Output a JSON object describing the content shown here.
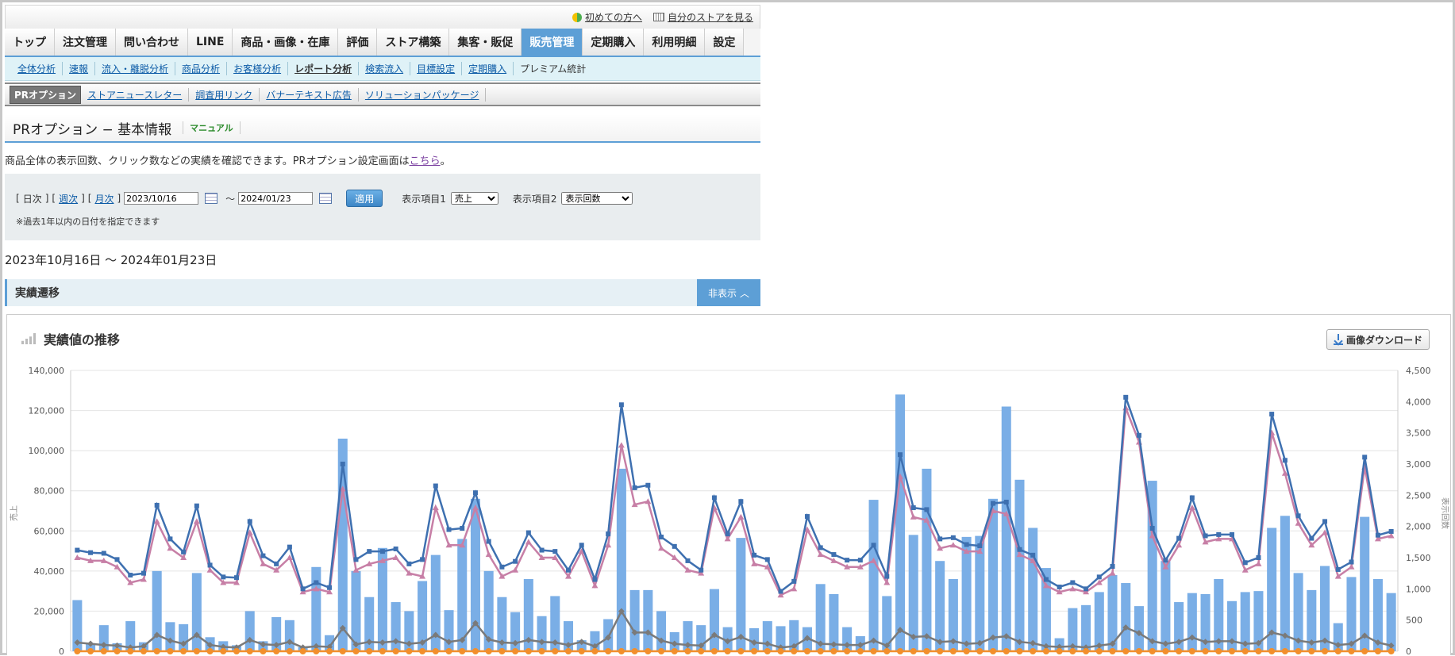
{
  "toplinks": {
    "first_time": "初めての方へ",
    "view_store": "自分のストアを見る"
  },
  "mainnav": [
    {
      "label": "トップ"
    },
    {
      "label": "注文管理"
    },
    {
      "label": "問い合わせ"
    },
    {
      "label": "LINE"
    },
    {
      "label": "商品・画像・在庫"
    },
    {
      "label": "評価"
    },
    {
      "label": "ストア構築"
    },
    {
      "label": "集客・販促"
    },
    {
      "label": "販売管理",
      "active": true
    },
    {
      "label": "定期購入"
    },
    {
      "label": "利用明細"
    },
    {
      "label": "設定"
    }
  ],
  "subnav": [
    "全体分析",
    "速報",
    "流入・離脱分析",
    "商品分析",
    "お客様分析",
    "レポート分析",
    "検索流入",
    "目標設定",
    "定期購入",
    "プレミアム統計"
  ],
  "thirdnav": [
    "PRオプション",
    "ストアニュースレター",
    "調査用リンク",
    "バナーテキスト広告",
    "ソリューションパッケージ"
  ],
  "page": {
    "title": "PRオプション − 基本情報",
    "manual": "マニュアル",
    "desc_prefix": "商品全体の表示回数、クリック数などの実績を確認できます。PRオプション設定画面は",
    "desc_link": "こちら",
    "desc_suffix": "。"
  },
  "filter": {
    "daily": "日次",
    "weekly": "週次",
    "monthly": "月次",
    "from": "2023/10/16",
    "to": "2024/01/23",
    "tilde": "〜",
    "apply": "適用",
    "item1_label": "表示項目1",
    "item1_value": "売上",
    "item2_label": "表示項目2",
    "item2_value": "表示回数",
    "note": "※過去1年以内の日付を指定できます"
  },
  "period": "2023年10月16日 〜 2024年01月23日",
  "section": {
    "title": "実績遷移",
    "hide": "非表示"
  },
  "chart_header": {
    "title": "実績値の推移",
    "download": "画像ダウンロード"
  },
  "chart_data": {
    "type": "bar",
    "y_left": {
      "label": "売上",
      "min": 0,
      "max": 140000,
      "ticks": [
        "0",
        "20,000",
        "40,000",
        "60,000",
        "80,000",
        "100,000",
        "120,000",
        "140,000"
      ]
    },
    "y_right": {
      "label": "表示回数",
      "min": 0,
      "max": 4500,
      "ticks": [
        "0",
        "500",
        "1,000",
        "1,500",
        "2,000",
        "2,500",
        "3,000",
        "3,500",
        "4,000",
        "4,500"
      ]
    },
    "bars_sales": [
      25500,
      4000,
      13000,
      4000,
      15000,
      4500,
      40000,
      14500,
      13500,
      39000,
      7000,
      5000,
      3000,
      20000,
      5000,
      17000,
      15500,
      2000,
      42000,
      8000,
      106000,
      40000,
      27000,
      51500,
      24500,
      20000,
      35000,
      48000,
      20500,
      56000,
      76000,
      40000,
      27000,
      19500,
      36000,
      17500,
      27500,
      15000,
      5500,
      10000,
      16000,
      91000,
      30500,
      30500,
      20000,
      9500,
      15000,
      13000,
      31000,
      12000,
      56500,
      11500,
      15000,
      12500,
      15500,
      12000,
      33500,
      28500,
      12000,
      7500,
      75500,
      27500,
      128000,
      58000,
      91000,
      45000,
      36000,
      57000,
      57500,
      76000,
      122000,
      85500,
      61500,
      41500,
      6500,
      21500,
      23000,
      29500,
      38000,
      34000,
      22500,
      85000,
      45000,
      24500,
      29000,
      28500,
      36000,
      25000,
      29500,
      30000,
      61500,
      67500,
      39000,
      30500,
      42500,
      14000,
      37000,
      67000,
      36000,
      29000
    ],
    "line_impressions": [
      1620,
      1580,
      1570,
      1470,
      1220,
      1250,
      2340,
      1800,
      1590,
      2330,
      1380,
      1190,
      1180,
      2080,
      1530,
      1400,
      1670,
      1000,
      1100,
      1020,
      3000,
      1470,
      1600,
      1600,
      1640,
      1400,
      1470,
      2650,
      1950,
      1970,
      2540,
      1760,
      1350,
      1440,
      1900,
      1620,
      1600,
      1300,
      1700,
      1150,
      1880,
      3950,
      2620,
      2660,
      1830,
      1680,
      1450,
      1300,
      2460,
      1880,
      2400,
      1540,
      1470,
      960,
      1120,
      2160,
      1660,
      1550,
      1460,
      1460,
      1700,
      1200,
      3150,
      2300,
      2270,
      1800,
      1820,
      1710,
      1690,
      2370,
      2390,
      1630,
      1540,
      1150,
      1030,
      1100,
      1000,
      1190,
      1360,
      4070,
      3460,
      1970,
      1460,
      1810,
      2460,
      1850,
      1870,
      1870,
      1420,
      1500,
      3800,
      3060,
      2170,
      1810,
      2080,
      1310,
      1430,
      3110,
      1860,
      1920
    ],
    "line_clicks": [
      1500,
      1450,
      1450,
      1350,
      1100,
      1150,
      2080,
      1650,
      1500,
      2080,
      1300,
      1100,
      1100,
      1900,
      1400,
      1300,
      1500,
      950,
      1000,
      950,
      2600,
      1300,
      1400,
      1450,
      1500,
      1250,
      1200,
      2300,
      1700,
      1700,
      2300,
      1550,
      1200,
      1300,
      1750,
      1500,
      1500,
      1200,
      1600,
      1050,
      1700,
      3300,
      2350,
      2400,
      1650,
      1500,
      1300,
      1250,
      2300,
      1800,
      2150,
      1400,
      1350,
      900,
      1000,
      1950,
      1550,
      1450,
      1350,
      1350,
      1450,
      1100,
      2800,
      2150,
      2100,
      1650,
      1700,
      1600,
      1600,
      2250,
      2200,
      1550,
      1450,
      1050,
      950,
      1000,
      950,
      1100,
      1250,
      3900,
      3350,
      1850,
      1350,
      1700,
      2300,
      1750,
      1800,
      1800,
      1300,
      1400,
      3500,
      2850,
      2050,
      1700,
      1900,
      1200,
      1350,
      2950,
      1800,
      1850
    ],
    "line_ctr": [
      140,
      120,
      100,
      90,
      60,
      80,
      260,
      170,
      120,
      260,
      100,
      70,
      60,
      180,
      110,
      100,
      150,
      60,
      80,
      70,
      370,
      110,
      150,
      140,
      160,
      120,
      140,
      260,
      150,
      180,
      450,
      190,
      140,
      130,
      180,
      150,
      140,
      100,
      150,
      80,
      220,
      640,
      300,
      300,
      170,
      120,
      100,
      90,
      260,
      160,
      230,
      140,
      120,
      60,
      80,
      210,
      120,
      110,
      100,
      100,
      170,
      90,
      340,
      230,
      240,
      150,
      160,
      120,
      130,
      220,
      240,
      150,
      130,
      80,
      70,
      80,
      60,
      90,
      120,
      380,
      290,
      160,
      120,
      150,
      220,
      150,
      160,
      160,
      120,
      130,
      300,
      250,
      170,
      140,
      170,
      100,
      120,
      250,
      140,
      90
    ],
    "line_zero": 0,
    "colors": {
      "bars": "#7aaee6",
      "impressions": "#3e70b0",
      "clicks": "#c77fa6",
      "ctr": "#7a7a7a",
      "zero": "#f28f2c"
    },
    "grid": true
  }
}
